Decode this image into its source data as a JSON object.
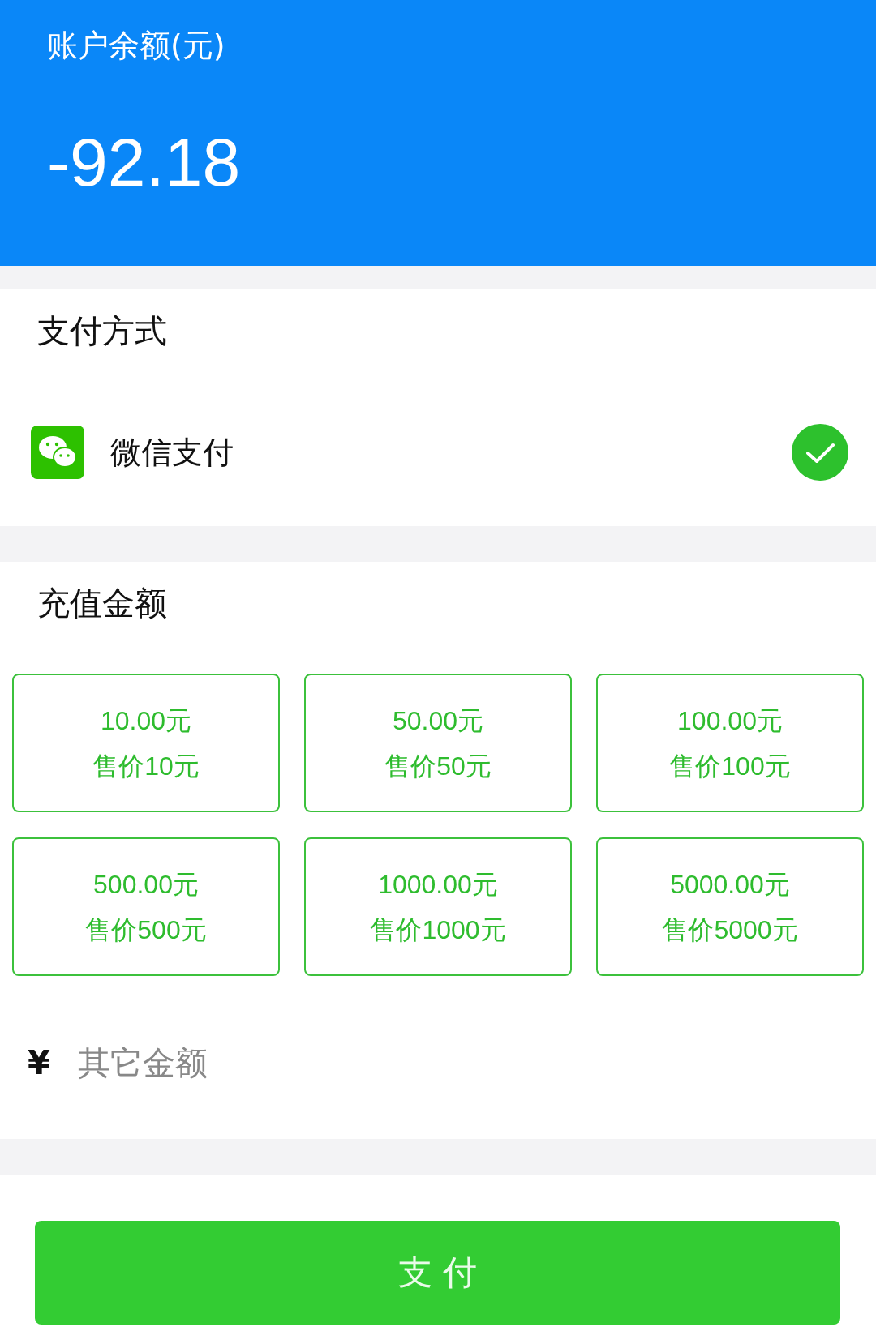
{
  "balance": {
    "label": "账户余额(元)",
    "amount": "-92.18"
  },
  "payment": {
    "title": "支付方式",
    "methods": [
      {
        "name": "微信支付",
        "checked": true
      }
    ]
  },
  "recharge": {
    "title": "充值金额",
    "options": [
      {
        "amount": "10.00元",
        "price": "售价10元"
      },
      {
        "amount": "50.00元",
        "price": "售价50元"
      },
      {
        "amount": "100.00元",
        "price": "售价100元"
      },
      {
        "amount": "500.00元",
        "price": "售价500元"
      },
      {
        "amount": "1000.00元",
        "price": "售价1000元"
      },
      {
        "amount": "5000.00元",
        "price": "售价5000元"
      }
    ],
    "currency": "¥",
    "other": {
      "placeholder": "其它金额"
    }
  },
  "pay_button": "支 付"
}
